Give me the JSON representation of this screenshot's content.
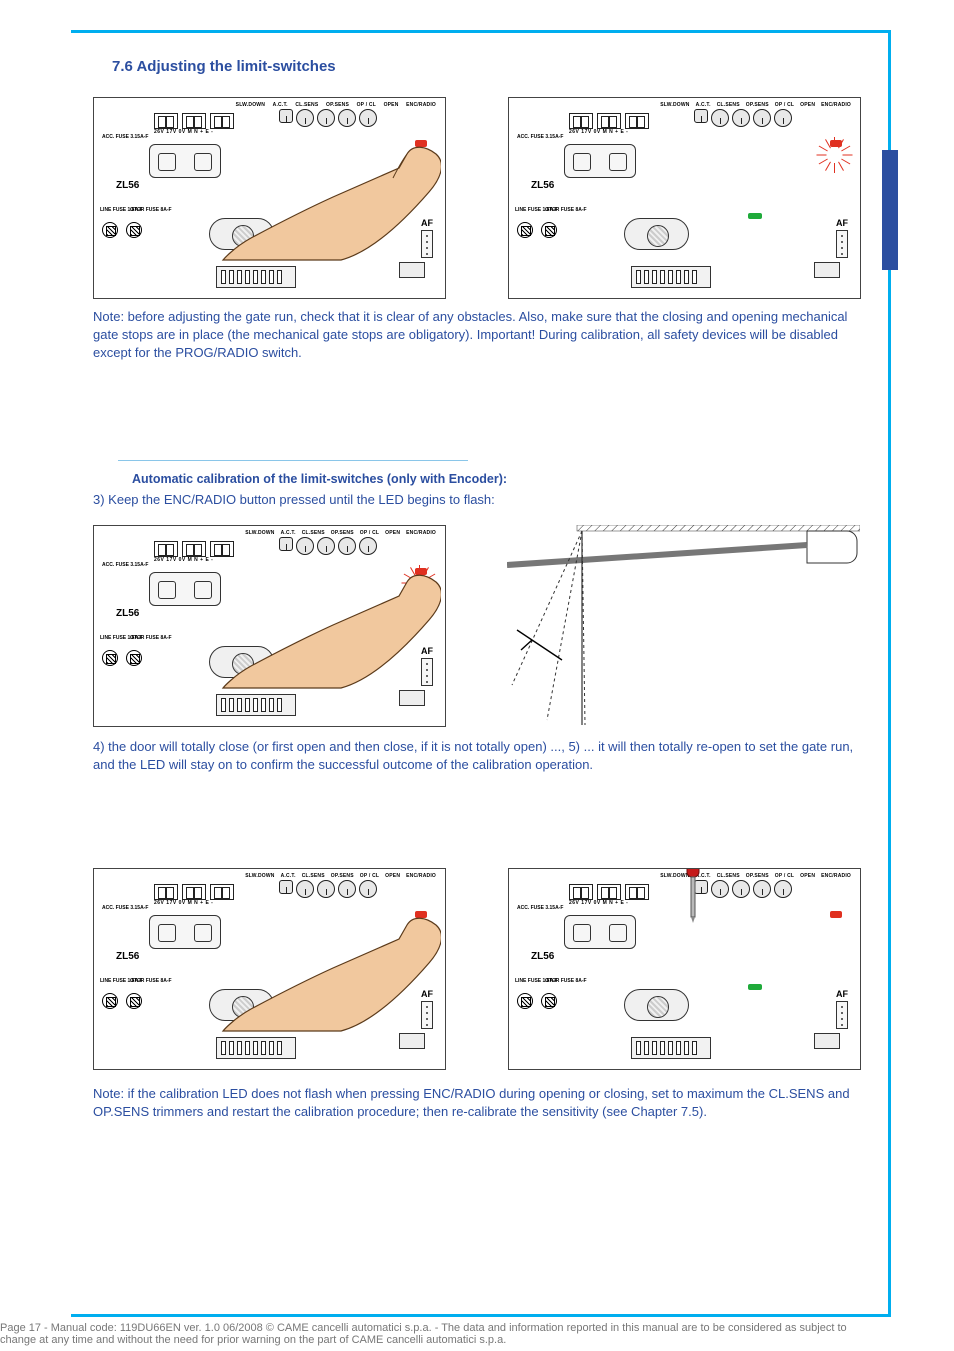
{
  "section_heading": "7.6 Adjusting the limit-switches",
  "text": {
    "below12": "Note: before adjusting the gate run, check that it is clear of any obstacles. Also, make sure that the closing and opening mechanical gate stops are in place (the mechanical gate stops are obligatory).\nImportant! During calibration, all safety devices will be disabled except for the PROG/RADIO switch.",
    "sub_title": "Automatic calibration of the limit-switches (only with Encoder):",
    "below3": "3) Keep the ENC/RADIO button pressed until the LED begins to flash:",
    "below45": "4) the door will totally close (or first open and then close, if it is not totally open) ...,\n5) ... it will then totally re-open to set the gate run, and the LED will stay on to confirm the successful outcome of the calibration operation.",
    "below6": "Note: if the calibration LED does not flash when pressing ENC/RADIO during opening or closing, set to maximum the CL.SENS and OP.SENS trimmers and restart the calibration procedure; then re-calibrate the sensitivity (see Chapter 7.5)."
  },
  "panel": {
    "top_labels": [
      "SLW.DOWN",
      "A.C.T.",
      "CL.SENS",
      "OP.SENS",
      "OP / CL",
      "OPEN",
      "ENC/RADIO"
    ],
    "zl": "ZL56",
    "acc_fuse": "ACC. FUSE 3.15A-F",
    "line_fuse": "LINE FUSE\n1.6A-F",
    "motor_fuse": "OTOR FUSE\n8A-F",
    "af": "AF",
    "term_labels": "26V 17V 0V   M  N     +   E   -"
  },
  "footer": "Page 17 - Manual code: 119DU66EN ver. 1.0 06/2008 © CAME cancelli automatici s.p.a. - The data and information reported in this manual are to be considered as subject to change at any time and without the need for prior warning on the part of CAME cancelli automatici s.p.a.",
  "chart_data": {
    "type": "table",
    "note": "Instruction manual page with six illustrative figures (no quantitative chart).",
    "figures": [
      {
        "id": 1,
        "description": "Finger pressing ENC/RADIO on ZL56 board; LED lit."
      },
      {
        "id": 2,
        "description": "ZL56 board with ENC/RADIO LED flashing (rays)."
      },
      {
        "id": 3,
        "description": "Finger holding ENC/RADIO; LED flashing."
      },
      {
        "id": 4,
        "description": "Side view of overhead/sectional door operator with door swinging path (arrow)."
      },
      {
        "id": 5,
        "description": "Finger pressing ENC/RADIO; LED on (calibration in progress)."
      },
      {
        "id": 6,
        "description": "Screwdriver adjusting CL.SENS/OP.SENS trimmers on ZL56 board."
      }
    ]
  }
}
